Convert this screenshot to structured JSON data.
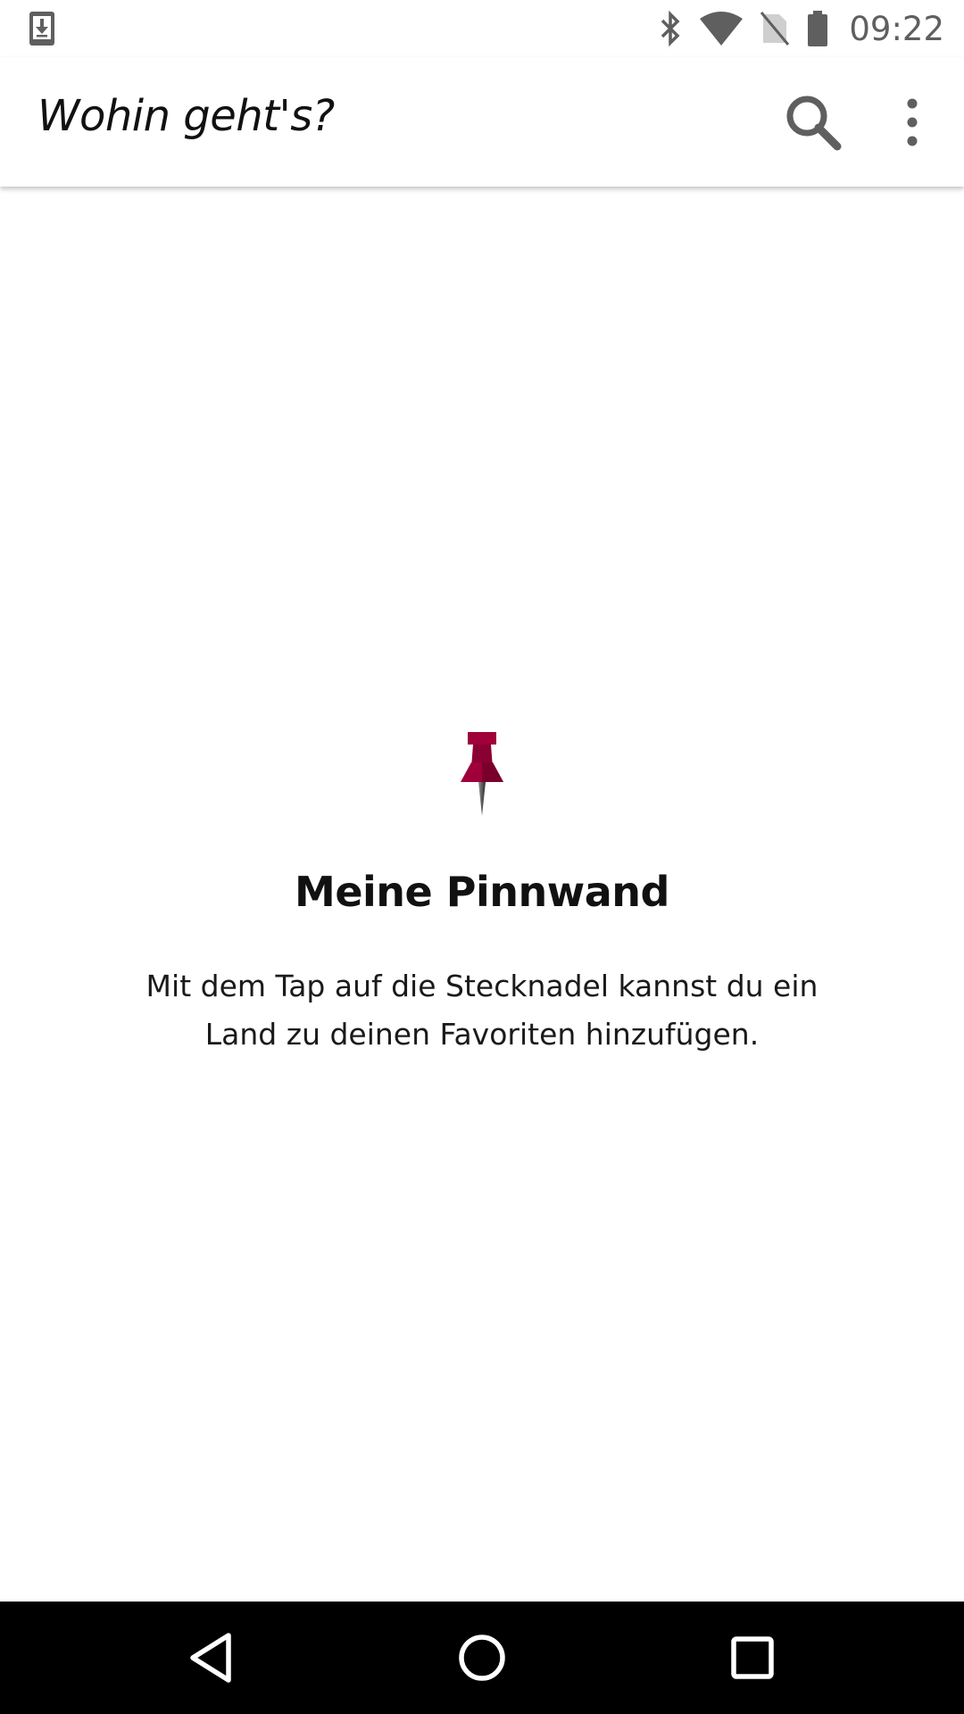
{
  "status_bar": {
    "time": "09:22",
    "icons": [
      "download-notification-icon",
      "bluetooth-icon",
      "wifi-icon",
      "no-sim-icon",
      "battery-icon"
    ]
  },
  "app_bar": {
    "title": "Wohin geht's?",
    "actions": [
      "search-icon",
      "more-vert-icon"
    ]
  },
  "empty_state": {
    "icon": "pushpin-icon",
    "title": "Meine Pinnwand",
    "text": "Mit dem Tap auf die Stecknadel kannst du ein Land zu deinen Favoriten hinzufügen."
  },
  "nav_bar": {
    "buttons": [
      "back-icon",
      "home-icon",
      "recents-icon"
    ]
  },
  "colors": {
    "pin_accent": "#a0003a",
    "status_icons": "#5f5f5f",
    "text": "#111111",
    "nav_background": "#000000"
  }
}
